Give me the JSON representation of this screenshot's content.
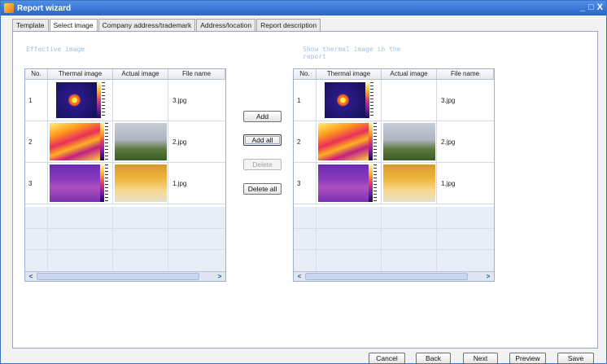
{
  "window": {
    "title": "Report wizard",
    "controls": [
      "_",
      "□",
      "X"
    ]
  },
  "tabs": [
    {
      "label": "Template",
      "active": false
    },
    {
      "label": "Select image",
      "active": true
    },
    {
      "label": "Company address/trademark",
      "active": false
    },
    {
      "label": "Address/location",
      "active": false
    },
    {
      "label": "Report description",
      "active": false
    }
  ],
  "left_section": {
    "label": "Effective image"
  },
  "right_section": {
    "label_line1": "Show thermal image in the",
    "label_line2": "report"
  },
  "columns": [
    "No.",
    "Thermal image",
    "Actual image",
    "File name"
  ],
  "left_rows": [
    {
      "no": "1",
      "file": "3.jpg",
      "thermal": "dark-spot",
      "actual": "none"
    },
    {
      "no": "2",
      "file": "2.jpg",
      "thermal": "substation",
      "actual": "substation-photo"
    },
    {
      "no": "3",
      "file": "1.jpg",
      "thermal": "purple-scene",
      "actual": "warm-photo"
    }
  ],
  "right_rows": [
    {
      "no": "1",
      "file": "3.jpg",
      "thermal": "dark-spot",
      "actual": "none"
    },
    {
      "no": "2",
      "file": "2.jpg",
      "thermal": "substation",
      "actual": "substation-photo"
    },
    {
      "no": "3",
      "file": "1.jpg",
      "thermal": "purple-scene",
      "actual": "warm-photo"
    }
  ],
  "middle_buttons": {
    "add": "Add",
    "add_all": "Add all",
    "delete": "Delete",
    "delete_all": "Delete all"
  },
  "footer": {
    "cancel": "Cancel",
    "back": "Back",
    "next": "Next",
    "preview": "Preview",
    "save": "Save"
  },
  "colors": {
    "titlebar": "#2a64c8",
    "grid_border": "#9cb1d2",
    "empty_fill": "#e9edf5"
  }
}
